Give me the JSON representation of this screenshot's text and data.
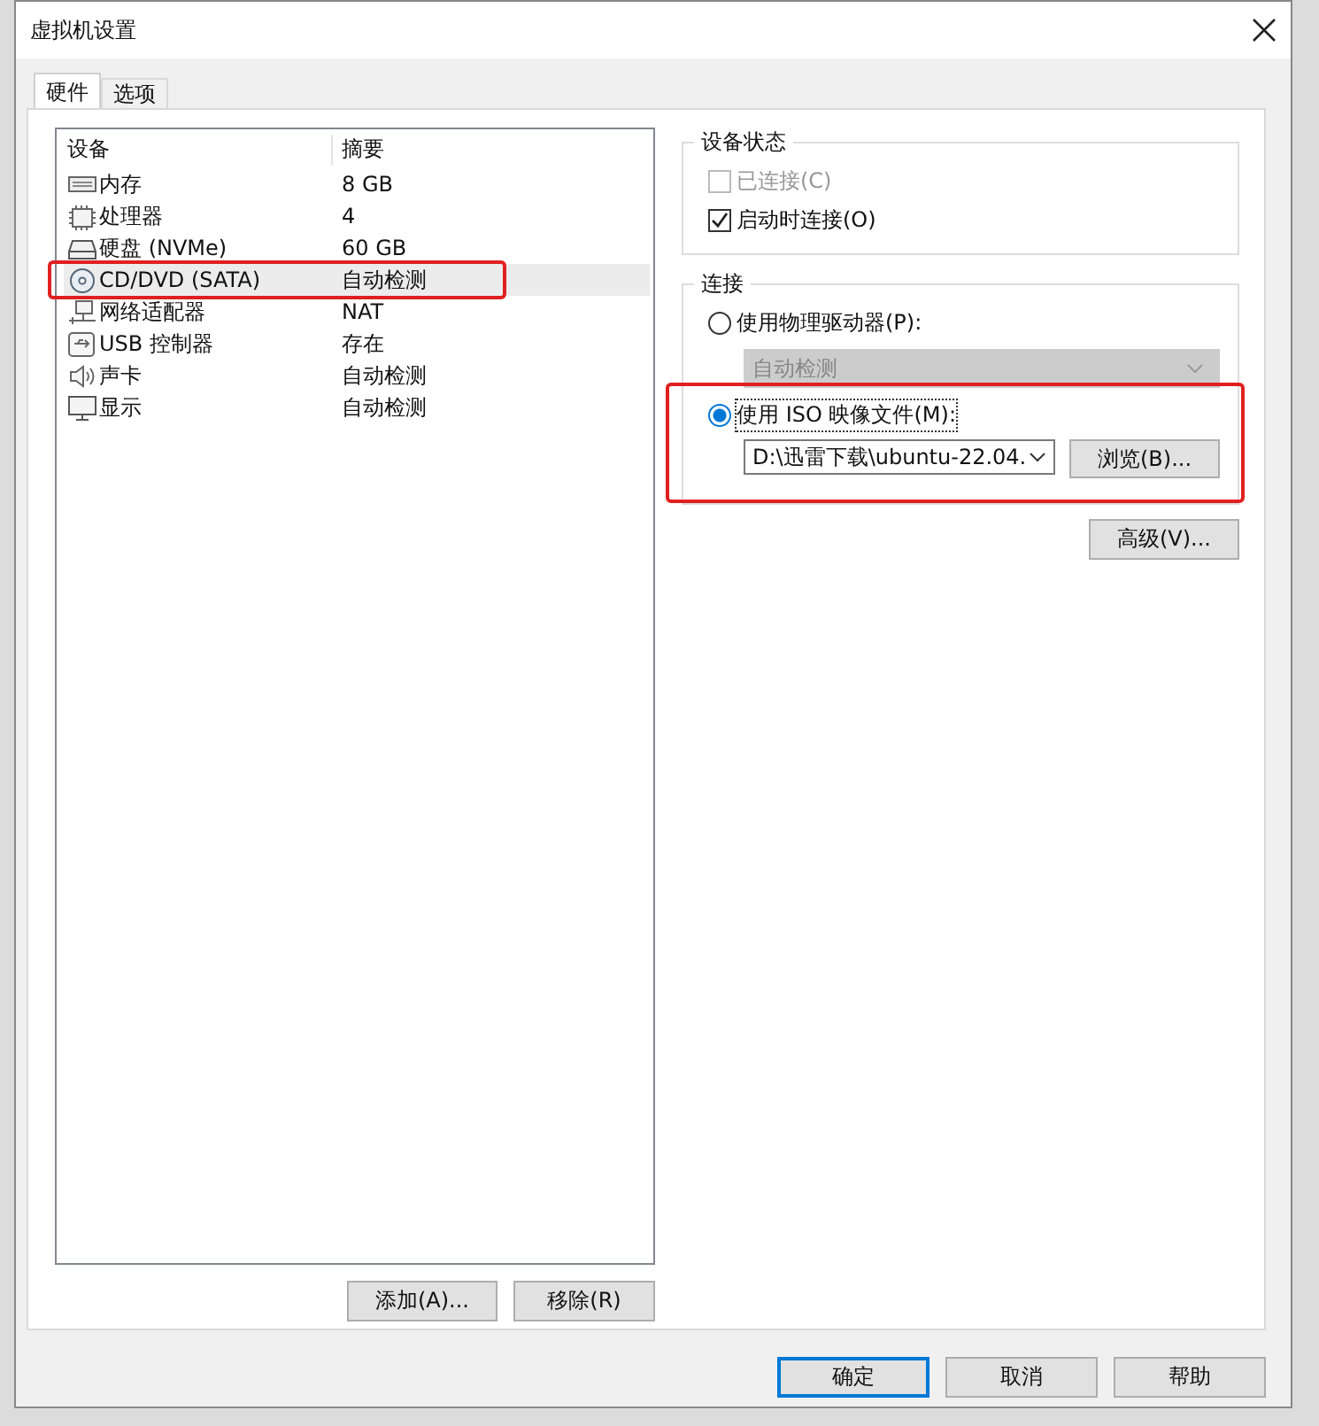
{
  "window": {
    "title": "虚拟机设置"
  },
  "tabs": [
    {
      "label": "硬件",
      "selected": true
    },
    {
      "label": "选项",
      "selected": false
    }
  ],
  "device_list": {
    "columns": [
      "设备",
      "摘要"
    ],
    "rows": [
      {
        "kind": "memory",
        "device": "内存",
        "summary": "8 GB",
        "selected": false,
        "highlighted": false
      },
      {
        "kind": "cpu",
        "device": "处理器",
        "summary": "4",
        "selected": false,
        "highlighted": false
      },
      {
        "kind": "disk",
        "device": "硬盘 (NVMe)",
        "summary": "60 GB",
        "selected": false,
        "highlighted": false
      },
      {
        "kind": "cdrom",
        "device": "CD/DVD (SATA)",
        "summary": "自动检测",
        "selected": true,
        "highlighted": true
      },
      {
        "kind": "network",
        "device": "网络适配器",
        "summary": "NAT",
        "selected": false,
        "highlighted": false
      },
      {
        "kind": "usb",
        "device": "USB 控制器",
        "summary": "存在",
        "selected": false,
        "highlighted": false
      },
      {
        "kind": "sound",
        "device": "声卡",
        "summary": "自动检测",
        "selected": false,
        "highlighted": false
      },
      {
        "kind": "display",
        "device": "显示",
        "summary": "自动检测",
        "selected": false,
        "highlighted": false
      }
    ]
  },
  "list_buttons": [
    "添加(A)...",
    "移除(R)"
  ],
  "device_status": {
    "title": "设备状态",
    "options": [
      {
        "label": "已连接(C)",
        "checked": false,
        "disabled": true
      },
      {
        "label": "启动时连接(O)",
        "checked": true,
        "disabled": false
      }
    ]
  },
  "connection": {
    "title": "连接",
    "physical": {
      "label": "使用物理驱动器(P):",
      "selected": false,
      "dropdown": {
        "value": "自动检测",
        "disabled": true
      }
    },
    "iso": {
      "label": "使用 ISO 映像文件(M):",
      "selected": true,
      "highlighted": true,
      "path": "D:\\迅雷下载\\ubuntu-22.04.",
      "browse": "浏览(B)..."
    }
  },
  "advanced_button": "高级(V)...",
  "dialog_buttons": [
    {
      "label": "确定",
      "default": true
    },
    {
      "label": "取消",
      "default": false
    },
    {
      "label": "帮助",
      "default": false
    }
  ]
}
